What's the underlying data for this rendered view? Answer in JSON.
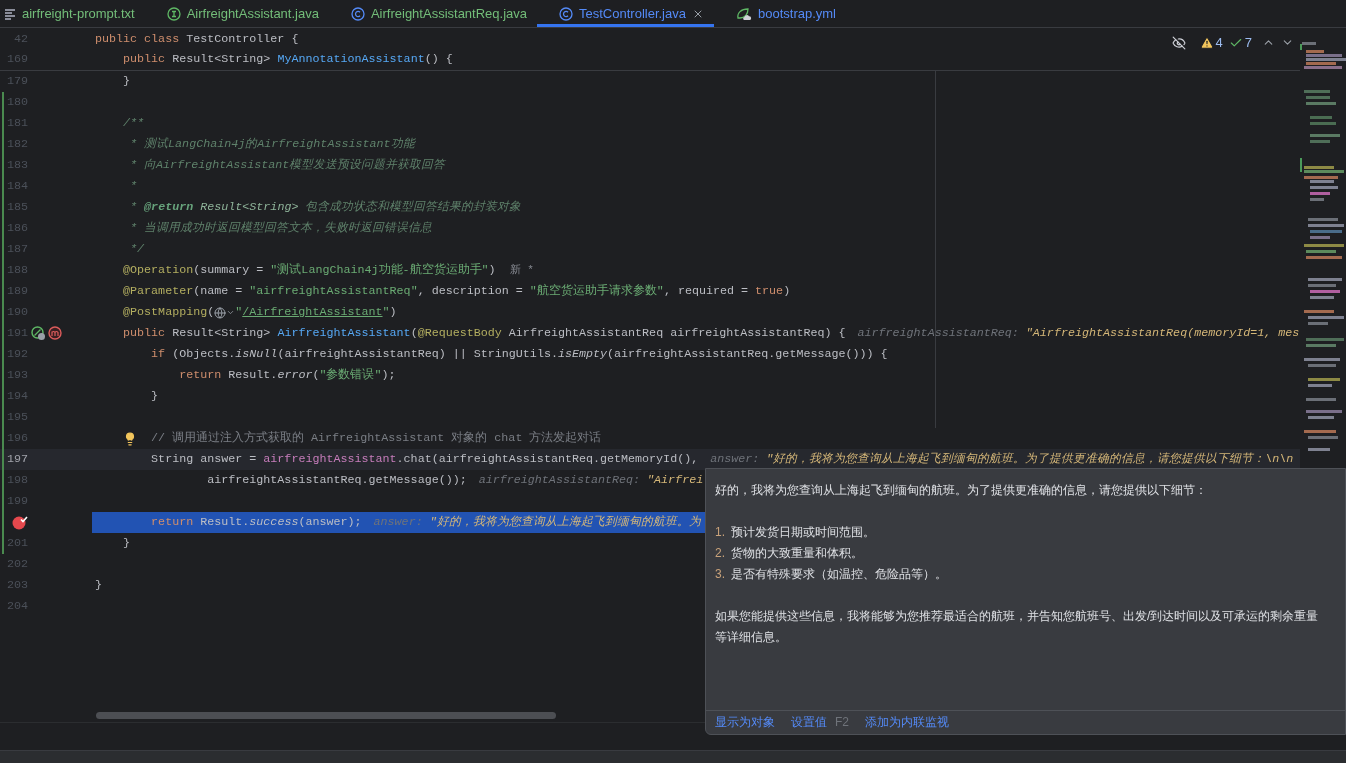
{
  "tabs": [
    {
      "label": "airfreight-prompt.txt",
      "kind": "text",
      "color": "#73bd79",
      "selected": false
    },
    {
      "label": "AirfreightAssistant.java",
      "kind": "interface",
      "color": "#73bd79",
      "selected": false
    },
    {
      "label": "AirfreightAssistantReq.java",
      "kind": "class",
      "color": "#73bd79",
      "selected": false
    },
    {
      "label": "TestController.java",
      "kind": "class",
      "color": "#548af7",
      "selected": true
    },
    {
      "label": "bootstrap.yml",
      "kind": "yaml",
      "color": "#548af7",
      "selected": false
    }
  ],
  "inspections": {
    "warnings": "4",
    "checks": "7"
  },
  "sticky_lines": [
    {
      "number": "42",
      "tokens": [
        {
          "kind": "kw",
          "text": "public class "
        },
        {
          "kind": "txt",
          "text": "TestController {"
        }
      ]
    },
    {
      "number": "169",
      "tokens": [
        {
          "kind": "kw",
          "text": "    public "
        },
        {
          "kind": "txt",
          "text": "Result<String> "
        },
        {
          "kind": "decl",
          "text": "MyAnnotationAssistant"
        },
        {
          "kind": "txt",
          "text": "() {"
        }
      ]
    }
  ],
  "lines": [
    {
      "number": "179",
      "changed": false,
      "caret": false,
      "selected": false,
      "tokens": [
        {
          "kind": "txt",
          "text": "    }"
        }
      ]
    },
    {
      "number": "180",
      "changed": true,
      "caret": false,
      "selected": false
    },
    {
      "number": "181",
      "changed": true,
      "caret": false,
      "selected": false,
      "tokens": [
        {
          "kind": "doc",
          "text": "    /**"
        }
      ]
    },
    {
      "number": "182",
      "changed": true,
      "caret": false,
      "selected": false,
      "tokens": [
        {
          "kind": "doc",
          "text": "     * 测试LangChain4j的AirfreightAssistant功能"
        }
      ]
    },
    {
      "number": "183",
      "changed": true,
      "caret": false,
      "selected": false,
      "tokens": [
        {
          "kind": "doc",
          "text": "     * 向AirfreightAssistant模型发送预设问题并获取回答"
        }
      ]
    },
    {
      "number": "184",
      "changed": true,
      "caret": false,
      "selected": false,
      "tokens": [
        {
          "kind": "doc",
          "text": "     *"
        }
      ]
    },
    {
      "number": "185",
      "changed": true,
      "caret": false,
      "selected": false,
      "tokens": [
        {
          "kind": "doc",
          "text": "     * "
        },
        {
          "kind": "doctag",
          "text": "@return"
        },
        {
          "kind": "docref",
          "text": " Result<String>"
        },
        {
          "kind": "doc",
          "text": " 包含成功状态和模型回答结果的封装对象"
        }
      ]
    },
    {
      "number": "186",
      "changed": true,
      "caret": false,
      "selected": false,
      "tokens": [
        {
          "kind": "doc",
          "text": "     * 当调用成功时返回模型回答文本，失败时返回错误信息"
        }
      ]
    },
    {
      "number": "187",
      "changed": true,
      "caret": false,
      "selected": false,
      "tokens": [
        {
          "kind": "doc",
          "text": "     */"
        }
      ]
    },
    {
      "number": "188",
      "changed": true,
      "caret": false,
      "selected": false,
      "tokens": [
        {
          "kind": "ann",
          "text": "    @Operation"
        },
        {
          "kind": "txt",
          "text": "(summary = "
        },
        {
          "kind": "str",
          "text": "\"测试LangChain4j功能-航空货运助手\""
        },
        {
          "kind": "txt",
          "text": ")"
        },
        {
          "kind": "inlay",
          "text": "新 *"
        }
      ]
    },
    {
      "number": "189",
      "changed": true,
      "caret": false,
      "selected": false,
      "tokens": [
        {
          "kind": "ann",
          "text": "    @Parameter"
        },
        {
          "kind": "txt",
          "text": "(name = "
        },
        {
          "kind": "str",
          "text": "\"airfreightAssistantReq\""
        },
        {
          "kind": "txt",
          "text": ", description = "
        },
        {
          "kind": "str",
          "text": "\"航空货运助手请求参数\""
        },
        {
          "kind": "txt",
          "text": ", required = "
        },
        {
          "kind": "kw",
          "text": "true"
        },
        {
          "kind": "txt",
          "text": ")"
        }
      ]
    },
    {
      "number": "190",
      "changed": true,
      "caret": false,
      "selected": false,
      "tokens": [
        {
          "kind": "ann",
          "text": "    @PostMapping"
        },
        {
          "kind": "txt",
          "text": "("
        },
        {
          "kind": "globe"
        },
        {
          "kind": "str",
          "text": "\""
        },
        {
          "kind": "link",
          "text": "/AirfreightAssistant"
        },
        {
          "kind": "str",
          "text": "\""
        },
        {
          "kind": "txt",
          "text": ")"
        }
      ]
    },
    {
      "number": "191",
      "changed": true,
      "caret": false,
      "selected": false,
      "gutter": [
        {
          "kind": "endpoint"
        },
        {
          "kind": "mapping"
        }
      ],
      "tokens": [
        {
          "kind": "kw",
          "text": "    public "
        },
        {
          "kind": "txt",
          "text": "Result<String> "
        },
        {
          "kind": "decl",
          "text": "AirfreightAssistant"
        },
        {
          "kind": "txt",
          "text": "("
        },
        {
          "kind": "ann",
          "text": "@RequestBody"
        },
        {
          "kind": "txt",
          "text": " AirfreightAssistantReq airfreightAssistantReq) {"
        },
        {
          "kind": "hl",
          "text": "airfreightAssistantReq: "
        },
        {
          "kind": "hv",
          "text": "\"AirfreightAssistantReq(memoryId=1, mes"
        }
      ]
    },
    {
      "number": "192",
      "changed": true,
      "caret": false,
      "selected": false,
      "tokens": [
        {
          "kind": "kw",
          "text": "        if "
        },
        {
          "kind": "txt",
          "text": "(Objects."
        },
        {
          "kind": "it",
          "text": "isNull"
        },
        {
          "kind": "txt",
          "text": "(airfreightAssistantReq) || StringUtils."
        },
        {
          "kind": "it",
          "text": "isEmpty"
        },
        {
          "kind": "txt",
          "text": "(airfreightAssistantReq.getMessage())) {"
        }
      ]
    },
    {
      "number": "193",
      "changed": true,
      "caret": false,
      "selected": false,
      "tokens": [
        {
          "kind": "kw",
          "text": "            return "
        },
        {
          "kind": "txt",
          "text": "Result."
        },
        {
          "kind": "it",
          "text": "error"
        },
        {
          "kind": "txt",
          "text": "("
        },
        {
          "kind": "str",
          "text": "\"参数错误\""
        },
        {
          "kind": "txt",
          "text": ");"
        }
      ]
    },
    {
      "number": "194",
      "changed": true,
      "caret": false,
      "selected": false,
      "tokens": [
        {
          "kind": "txt",
          "text": "        }"
        }
      ]
    },
    {
      "number": "195",
      "changed": true,
      "caret": false,
      "selected": false
    },
    {
      "number": "196",
      "changed": true,
      "caret": false,
      "selected": false,
      "tokens": [
        {
          "kind": "bulb"
        },
        {
          "kind": "cmt",
          "text": "// 调用通过注入方式获取的 AirfreightAssistant 对象的 chat 方法发起对话"
        }
      ]
    },
    {
      "number": "197",
      "changed": true,
      "caret": true,
      "selected": false,
      "tokens": [
        {
          "kind": "txt",
          "text": "        String answer = "
        },
        {
          "kind": "field",
          "text": "airfreightAssistant"
        },
        {
          "kind": "txt",
          "text": ".chat(airfreightAssistantReq.getMemoryId(),"
        },
        {
          "kind": "hl",
          "text": "answer: "
        },
        {
          "kind": "hv",
          "text": "\"好的，我将为您查询从上海起飞到缅甸的航班。为了提供更准确的信息，请您提供以下细节：\\n\\n"
        }
      ]
    },
    {
      "number": "198",
      "changed": true,
      "caret": false,
      "selected": false,
      "tokens": [
        {
          "kind": "txt",
          "text": "                airfreightAssistantReq.getMessage());"
        },
        {
          "kind": "hl",
          "text": "airfreightAssistantReq: "
        },
        {
          "kind": "hv",
          "text": "\"Airfrei"
        }
      ]
    },
    {
      "number": "199",
      "changed": true,
      "caret": false,
      "selected": false
    },
    {
      "breakpoint": true,
      "changed": true,
      "caret": false,
      "selected": true,
      "tokens": [
        {
          "kind": "kw",
          "text": "        return "
        },
        {
          "kind": "txt",
          "text": "Result."
        },
        {
          "kind": "it",
          "text": "success"
        },
        {
          "kind": "txt",
          "text": "(answer);"
        },
        {
          "kind": "hl",
          "text": "answer: "
        },
        {
          "kind": "hv",
          "text": "\"好的，我将为您查询从上海起飞到缅甸的航班。为"
        }
      ]
    },
    {
      "number": "201",
      "changed": true,
      "caret": false,
      "selected": false,
      "tokens": [
        {
          "kind": "txt",
          "text": "    }"
        }
      ]
    },
    {
      "number": "202",
      "changed": false,
      "caret": false,
      "selected": false
    },
    {
      "number": "203",
      "changed": false,
      "caret": false,
      "selected": false,
      "tokens": [
        {
          "kind": "txt",
          "text": "}"
        }
      ]
    },
    {
      "number": "204",
      "changed": false,
      "caret": false,
      "selected": false
    }
  ],
  "value_popup": {
    "intro": "好的，我将为您查询从上海起飞到缅甸的航班。为了提供更准确的信息，请您提供以下细节：",
    "items": [
      {
        "number": "1.",
        "text": "预计发货日期或时间范围。"
      },
      {
        "number": "2.",
        "text": "货物的大致重量和体积。"
      },
      {
        "number": "3.",
        "text": "是否有特殊要求（如温控、危险品等）。"
      }
    ],
    "paragraph": "如果您能提供这些信息，我将能够为您推荐最适合的航班，并告知您航班号、出发/到达时间以及可承运的剩余重量等详细信息。",
    "actions": [
      {
        "label": "显示为对象"
      },
      {
        "label": "设置值",
        "shortcut": "F2"
      },
      {
        "label": "添加为内联监视"
      }
    ]
  }
}
